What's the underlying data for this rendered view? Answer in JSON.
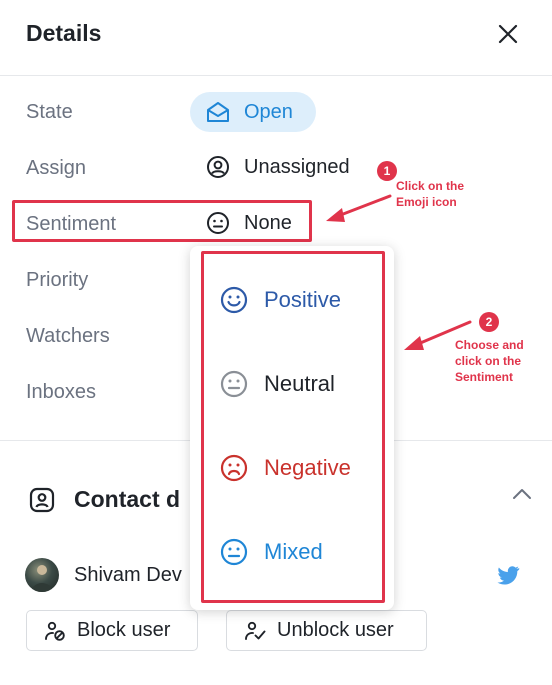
{
  "header": {
    "title": "Details"
  },
  "rows": [
    {
      "label": "State",
      "value": "Open"
    },
    {
      "label": "Assign",
      "value": "Unassigned"
    },
    {
      "label": "Sentiment",
      "value": "None"
    },
    {
      "label": "Priority"
    },
    {
      "label": "Watchers"
    },
    {
      "label": "Inboxes"
    }
  ],
  "sentiment_options": [
    {
      "label": "Positive",
      "color": "#2d5aa8"
    },
    {
      "label": "Neutral",
      "color": "#1f2329"
    },
    {
      "label": "Negative",
      "color": "#c9322c"
    },
    {
      "label": "Mixed",
      "color": "#1f86d6"
    }
  ],
  "annotations": [
    {
      "number": "1",
      "text_line1": "Click on the",
      "text_line2": "Emoji icon"
    },
    {
      "number": "2",
      "text_line1": "Choose and",
      "text_line2": "click on the",
      "text_line3": "Sentiment"
    }
  ],
  "contact": {
    "title_visible": "Contact d",
    "name_visible": "Shivam Dev",
    "block_label": "Block user",
    "unblock_label": "Unblock user"
  },
  "colors": {
    "accent": "#1f86d6",
    "annotation_red": "#e0344b"
  }
}
